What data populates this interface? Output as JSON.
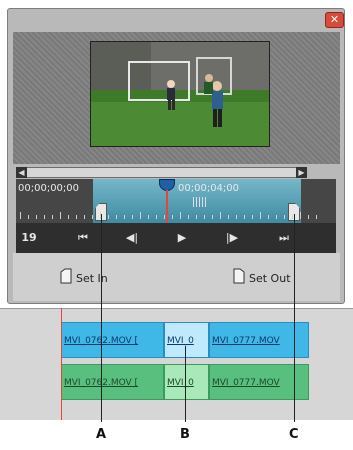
{
  "window": {
    "close_icon": "close-icon"
  },
  "monitor": {
    "timecode_start": "00;00;00;00",
    "timecode_current": "00;00;04;00",
    "frame_counter": "19"
  },
  "transport": {
    "go_to_in_icon": "go-to-in-icon",
    "step_back_icon": "step-back-icon",
    "play_icon": "play-icon",
    "step_forward_icon": "step-forward-icon",
    "go_to_out_icon": "go-to-out-icon"
  },
  "buttons": {
    "set_in": "Set In",
    "set_out": "Set Out"
  },
  "timeline": {
    "video_clips": [
      "MVI_0762.MOV [",
      "MVI_0",
      "MVI_0777.MOV"
    ],
    "audio_clips": [
      "MVI_0762.MOV [",
      "MVI_0",
      "MVI_0777.MOV"
    ]
  },
  "callouts": [
    "A",
    "B",
    "C"
  ],
  "colors": {
    "range_accent": "#5aa8c0",
    "playhead": "#e8443a",
    "video_clip": "#3fb8e8",
    "audio_clip": "#58bf7f",
    "selected_clip": "#bfe9ff"
  }
}
